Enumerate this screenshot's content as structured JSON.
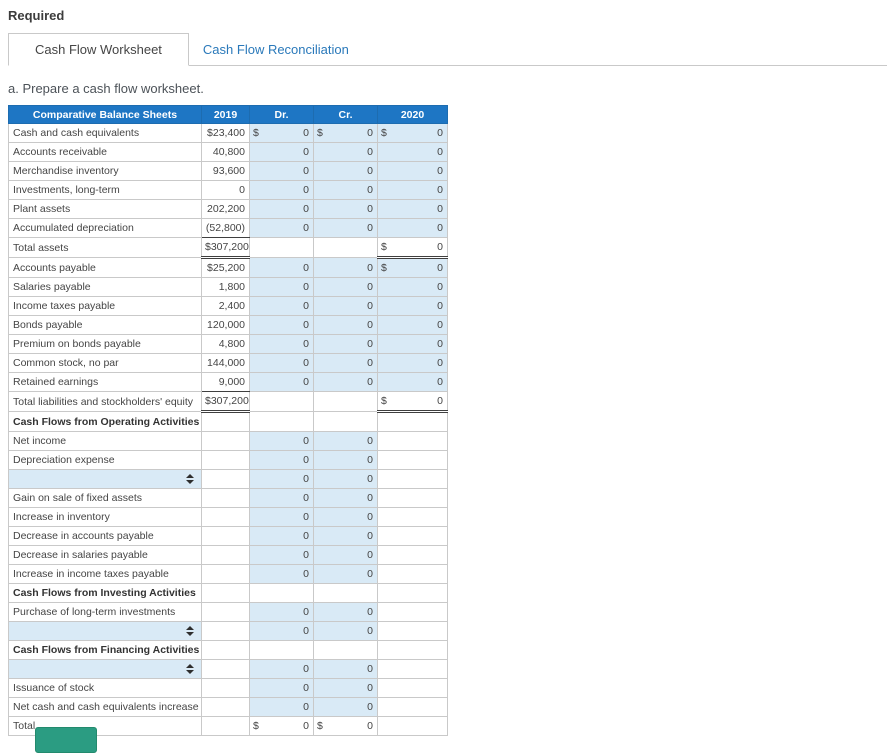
{
  "page": {
    "required_label": "Required",
    "instruction": "a. Prepare a cash flow worksheet."
  },
  "tabs": [
    {
      "id": "cash-flow-worksheet",
      "label": "Cash Flow Worksheet",
      "active": true
    },
    {
      "id": "cash-flow-reconciliation",
      "label": "Cash Flow Reconciliation",
      "active": false
    }
  ],
  "colors": {
    "header_bg": "#1e76c4",
    "input_cell_bg": "#d9eaf6",
    "tab_link_blue": "#2a79ba",
    "bottom_button_green": "#2b9c82"
  },
  "table": {
    "headers": [
      "Comparative Balance Sheets",
      "2019",
      "Dr.",
      "Cr.",
      "2020"
    ],
    "rows": [
      {
        "type": "data",
        "label": "Cash and cash equivalents",
        "y2019": {
          "v": "$23,400"
        },
        "dr": {
          "p": "$",
          "v": "0",
          "input": true
        },
        "cr": {
          "p": "$",
          "v": "0",
          "input": true
        },
        "y2020": {
          "p": "$",
          "v": "0",
          "input": true
        }
      },
      {
        "type": "data",
        "label": "Accounts receivable",
        "y2019": {
          "v": "40,800"
        },
        "dr": {
          "v": "0",
          "input": true
        },
        "cr": {
          "v": "0",
          "input": true
        },
        "y2020": {
          "v": "0",
          "input": true
        }
      },
      {
        "type": "data",
        "label": "Merchandise inventory",
        "y2019": {
          "v": "93,600"
        },
        "dr": {
          "v": "0",
          "input": true
        },
        "cr": {
          "v": "0",
          "input": true
        },
        "y2020": {
          "v": "0",
          "input": true
        }
      },
      {
        "type": "data",
        "label": "Investments, long-term",
        "y2019": {
          "v": "0"
        },
        "dr": {
          "v": "0",
          "input": true
        },
        "cr": {
          "v": "0",
          "input": true
        },
        "y2020": {
          "v": "0",
          "input": true
        }
      },
      {
        "type": "data",
        "label": "Plant assets",
        "y2019": {
          "v": "202,200"
        },
        "dr": {
          "v": "0",
          "input": true
        },
        "cr": {
          "v": "0",
          "input": true
        },
        "y2020": {
          "v": "0",
          "input": true
        }
      },
      {
        "type": "data",
        "label": "Accumulated depreciation",
        "y2019": {
          "v": "(52,800)",
          "rule": "single"
        },
        "dr": {
          "v": "0",
          "input": true
        },
        "cr": {
          "v": "0",
          "input": true
        },
        "y2020": {
          "v": "0",
          "input": true
        }
      },
      {
        "type": "data",
        "label": "Total assets",
        "y2019": {
          "v": "$307,200",
          "rule": "double"
        },
        "dr": null,
        "cr": null,
        "y2020": {
          "p": "$",
          "v": "0",
          "rule": "double"
        }
      },
      {
        "type": "data",
        "label": "Accounts payable",
        "y2019": {
          "v": "$25,200"
        },
        "dr": {
          "v": "0",
          "input": true
        },
        "cr": {
          "v": "0",
          "input": true
        },
        "y2020": {
          "p": "$",
          "v": "0",
          "input": true
        }
      },
      {
        "type": "data",
        "label": "Salaries payable",
        "y2019": {
          "v": "1,800"
        },
        "dr": {
          "v": "0",
          "input": true
        },
        "cr": {
          "v": "0",
          "input": true
        },
        "y2020": {
          "v": "0",
          "input": true
        }
      },
      {
        "type": "data",
        "label": "Income taxes payable",
        "y2019": {
          "v": "2,400"
        },
        "dr": {
          "v": "0",
          "input": true
        },
        "cr": {
          "v": "0",
          "input": true
        },
        "y2020": {
          "v": "0",
          "input": true
        }
      },
      {
        "type": "data",
        "label": "Bonds payable",
        "y2019": {
          "v": "120,000"
        },
        "dr": {
          "v": "0",
          "input": true
        },
        "cr": {
          "v": "0",
          "input": true
        },
        "y2020": {
          "v": "0",
          "input": true
        }
      },
      {
        "type": "data",
        "label": "Premium on bonds payable",
        "y2019": {
          "v": "4,800"
        },
        "dr": {
          "v": "0",
          "input": true
        },
        "cr": {
          "v": "0",
          "input": true
        },
        "y2020": {
          "v": "0",
          "input": true
        }
      },
      {
        "type": "data",
        "label": "Common stock, no par",
        "y2019": {
          "v": "144,000"
        },
        "dr": {
          "v": "0",
          "input": true
        },
        "cr": {
          "v": "0",
          "input": true
        },
        "y2020": {
          "v": "0",
          "input": true
        }
      },
      {
        "type": "data",
        "label": "Retained earnings",
        "y2019": {
          "v": "9,000",
          "rule": "single"
        },
        "dr": {
          "v": "0",
          "input": true
        },
        "cr": {
          "v": "0",
          "input": true
        },
        "y2020": {
          "v": "0",
          "input": true
        }
      },
      {
        "type": "data",
        "label": "Total liabilities and stockholders' equity",
        "y2019": {
          "v": "$307,200",
          "rule": "double"
        },
        "dr": null,
        "cr": null,
        "y2020": {
          "p": "$",
          "v": "0",
          "rule": "double"
        }
      },
      {
        "type": "section",
        "label": "Cash Flows from Operating Activities",
        "y2019": null,
        "dr": null,
        "cr": null,
        "y2020": null
      },
      {
        "type": "data",
        "label": "Net income",
        "y2019": null,
        "dr": {
          "v": "0",
          "input": true
        },
        "cr": {
          "v": "0",
          "input": true
        },
        "y2020": null
      },
      {
        "type": "data",
        "label": "Depreciation expense",
        "y2019": null,
        "dr": {
          "v": "0",
          "input": true
        },
        "cr": {
          "v": "0",
          "input": true
        },
        "y2020": null
      },
      {
        "type": "select",
        "label": "",
        "y2019": null,
        "dr": {
          "v": "0",
          "input": true
        },
        "cr": {
          "v": "0",
          "input": true
        },
        "y2020": null
      },
      {
        "type": "data",
        "label": "Gain on sale of fixed assets",
        "y2019": null,
        "dr": {
          "v": "0",
          "input": true
        },
        "cr": {
          "v": "0",
          "input": true
        },
        "y2020": null
      },
      {
        "type": "data",
        "label": "Increase in inventory",
        "y2019": null,
        "dr": {
          "v": "0",
          "input": true
        },
        "cr": {
          "v": "0",
          "input": true
        },
        "y2020": null
      },
      {
        "type": "data",
        "label": "Decrease in accounts payable",
        "y2019": null,
        "dr": {
          "v": "0",
          "input": true
        },
        "cr": {
          "v": "0",
          "input": true
        },
        "y2020": null
      },
      {
        "type": "data",
        "label": "Decrease in salaries payable",
        "y2019": null,
        "dr": {
          "v": "0",
          "input": true
        },
        "cr": {
          "v": "0",
          "input": true
        },
        "y2020": null
      },
      {
        "type": "data",
        "label": "Increase in income taxes payable",
        "y2019": null,
        "dr": {
          "v": "0",
          "input": true
        },
        "cr": {
          "v": "0",
          "input": true
        },
        "y2020": null
      },
      {
        "type": "section",
        "label": "Cash Flows from Investing Activities",
        "y2019": null,
        "dr": null,
        "cr": null,
        "y2020": null
      },
      {
        "type": "data",
        "label": "Purchase of long-term investments",
        "y2019": null,
        "dr": {
          "v": "0",
          "input": true
        },
        "cr": {
          "v": "0",
          "input": true
        },
        "y2020": null
      },
      {
        "type": "select",
        "label": "",
        "y2019": null,
        "dr": {
          "v": "0",
          "input": true
        },
        "cr": {
          "v": "0",
          "input": true
        },
        "y2020": null
      },
      {
        "type": "section",
        "label": "Cash Flows from Financing Activities",
        "y2019": null,
        "dr": null,
        "cr": null,
        "y2020": null
      },
      {
        "type": "select",
        "label": "",
        "y2019": null,
        "dr": {
          "v": "0",
          "input": true
        },
        "cr": {
          "v": "0",
          "input": true
        },
        "y2020": null
      },
      {
        "type": "data",
        "label": "Issuance of stock",
        "y2019": null,
        "dr": {
          "v": "0",
          "input": true
        },
        "cr": {
          "v": "0",
          "input": true
        },
        "y2020": null
      },
      {
        "type": "data",
        "label": "Net cash and cash equivalents increase",
        "y2019": null,
        "dr": {
          "v": "0",
          "input": true
        },
        "cr": {
          "v": "0",
          "input": true
        },
        "y2020": null
      },
      {
        "type": "data",
        "label": "Total",
        "y2019": null,
        "dr": {
          "p": "$",
          "v": "0"
        },
        "cr": {
          "p": "$",
          "v": "0"
        },
        "y2020": null
      }
    ]
  },
  "bottom_button": {
    "label": ""
  }
}
